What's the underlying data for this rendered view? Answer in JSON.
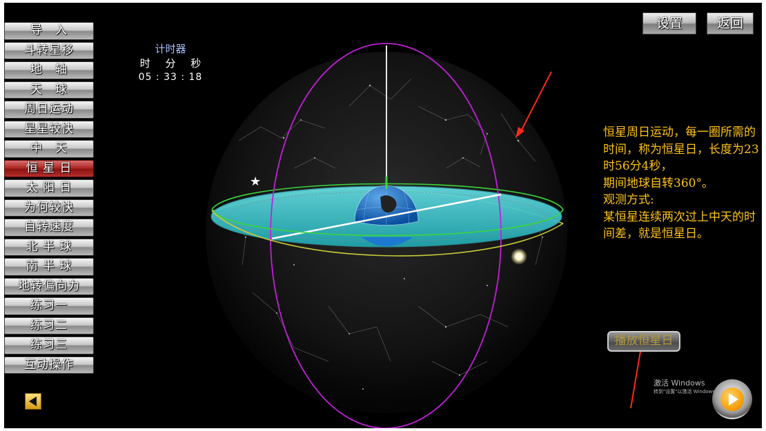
{
  "menu": {
    "items": [
      {
        "label": "导　入"
      },
      {
        "label": "斗转星移"
      },
      {
        "label": "地　轴"
      },
      {
        "label": "天　球"
      },
      {
        "label": "周日运动"
      },
      {
        "label": "星星较快"
      },
      {
        "label": "中　天"
      },
      {
        "label": "恒 星 日",
        "active": true
      },
      {
        "label": "太 阳 日"
      },
      {
        "label": "为何较快"
      },
      {
        "label": "自转速度"
      },
      {
        "label": "北 半 球"
      },
      {
        "label": "南 半 球"
      },
      {
        "label": "地转偏向力"
      },
      {
        "label": "练习一"
      },
      {
        "label": "练习二"
      },
      {
        "label": "练习三"
      },
      {
        "label": "互动操作"
      }
    ]
  },
  "timer": {
    "title": "计时器",
    "unit_h": "时",
    "unit_m": "分",
    "unit_s": "秒",
    "value": "05 : 33 : 18"
  },
  "toolbar": {
    "settings_label": "设置",
    "back_label": "返回"
  },
  "description": {
    "text": "恒星周日运动，每一圈所需的时间，称为恒星日，长度为23时56分4秒，\n期间地球自转360°。\n观测方式:\n某恒星连续两次过上中天的时间差，就是恒星日。"
  },
  "play_button": {
    "label": "播放恒星日"
  },
  "watermark": {
    "title": "激活 Windows",
    "subtitle": "转到\"设置\"以激活 Windows。"
  },
  "icons": {
    "back_arrow": "arrow-left-icon",
    "round_play": "play-icon",
    "star": "star-icon",
    "sun": "sun-icon"
  },
  "colors": {
    "background": "#000000",
    "menu_active": "#b02a27",
    "description_text": "#ffc21a",
    "timer_title": "#a9c4ff",
    "equator_plane": "#2fbfc6",
    "meridian": "#c21fd8",
    "horizon_ring": "#3bd63b",
    "ecliptic": "#d6d63b",
    "annotation_arrow": "#ff2a1a"
  }
}
